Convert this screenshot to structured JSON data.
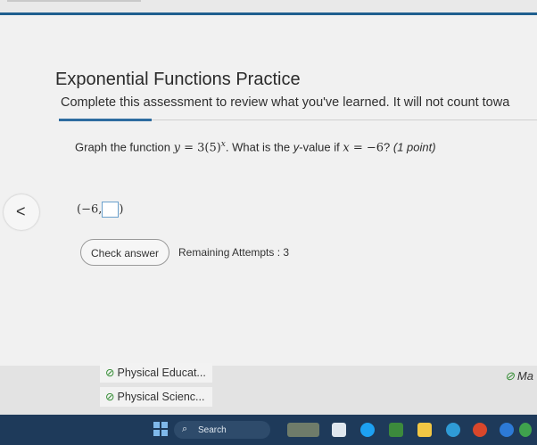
{
  "assessment": {
    "title": "Exponential Functions Practice",
    "subtitle": "Complete this assessment to review what you've learned. It will not count towa"
  },
  "question": {
    "prefix": "Graph the function ",
    "function_y": "y",
    "function_eq": " = 3(5)",
    "function_exp": "x",
    "middle": ". What is the ",
    "y_word": "y",
    "middle2": "-value if ",
    "x_var": "x",
    "x_eq": " = −6",
    "suffix": "? ",
    "points": "(1 point)"
  },
  "answer": {
    "prefix": "(−6,",
    "suffix": ")",
    "value": ""
  },
  "nav": {
    "prev_glyph": "<"
  },
  "actions": {
    "check_label": "Check answer",
    "remaining_label": "Remaining Attempts : 3"
  },
  "courses": [
    {
      "label": "Physical Educat..."
    },
    {
      "label": "Physical Scienc..."
    }
  ],
  "partial_course": "Ma",
  "taskbar": {
    "search_label": "Search"
  },
  "colors": {
    "accent": "#2d6ca0",
    "taskbar": "#1e3a5a",
    "check": "#2f8a2f"
  }
}
